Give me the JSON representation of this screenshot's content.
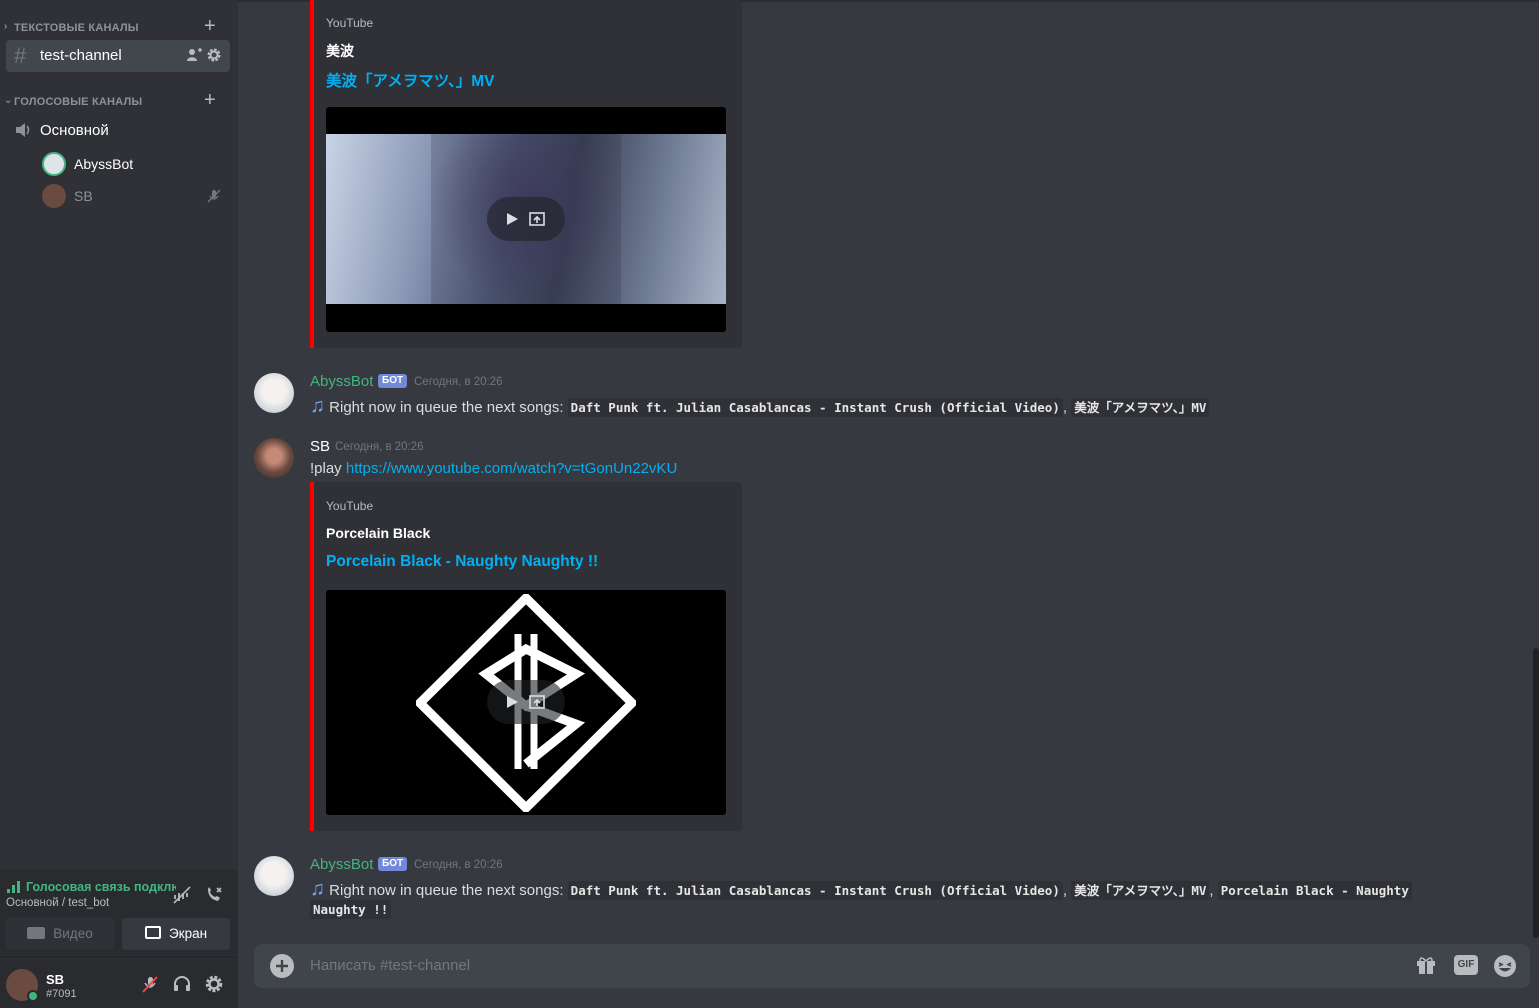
{
  "sidebar": {
    "text_category": "ТЕКСТОВЫЕ КАНАЛЫ",
    "text_channel": "test-channel",
    "voice_category": "ГОЛОСОВЫЕ КАНАЛЫ",
    "voice_channel": "Основной",
    "voice_users": [
      {
        "name": "AbyssBot",
        "color": "#ffffff"
      },
      {
        "name": "SB",
        "color": "#8e9297"
      }
    ]
  },
  "voice_panel": {
    "status": "Голосовая связь подключена",
    "location": "Основной / test_bot",
    "video_label": "Видео",
    "screen_label": "Экран"
  },
  "user": {
    "name": "SB",
    "tag": "#7091"
  },
  "messages": {
    "embed1": {
      "provider": "YouTube",
      "author": "美波",
      "title": "美波「アメヲマツ、」MV"
    },
    "msg1": {
      "author": "AbyssBot",
      "bot_tag": "БОТ",
      "time": "Сегодня, в 20:26",
      "prefix": "Right now in queue the next songs:",
      "song1": "Daft Punk ft. Julian Casablancas - Instant Crush (Official Video)",
      "sep": ",",
      "song2": "美波「アメヲマツ、」MV"
    },
    "msg2": {
      "author": "SB",
      "time": "Сегодня, в 20:26",
      "command": "!play",
      "url": "https://www.youtube.com/watch?v=tGonUn22vKU"
    },
    "embed2": {
      "provider": "YouTube",
      "author": "Porcelain Black",
      "title": "Porcelain Black - Naughty Naughty !!"
    },
    "msg3": {
      "author": "AbyssBot",
      "bot_tag": "БОТ",
      "time": "Сегодня, в 20:26",
      "prefix": "Right now in queue the next songs:",
      "song1": "Daft Punk ft. Julian Casablancas - Instant Crush (Official Video)",
      "sep1": ",",
      "song2": "美波「アメヲマツ、」MV",
      "sep2": ",",
      "song3a": "Porcelain Black - Naughty",
      "song3b": "Naughty !!"
    }
  },
  "composer": {
    "placeholder": "Написать #test-channel",
    "gif_label": "GIF"
  },
  "colors": {
    "bot_name": "#43b581",
    "accent": "#7289da",
    "link": "#00b0f4",
    "embed_border": "#ff0000",
    "voice_connected": "#43b581"
  }
}
